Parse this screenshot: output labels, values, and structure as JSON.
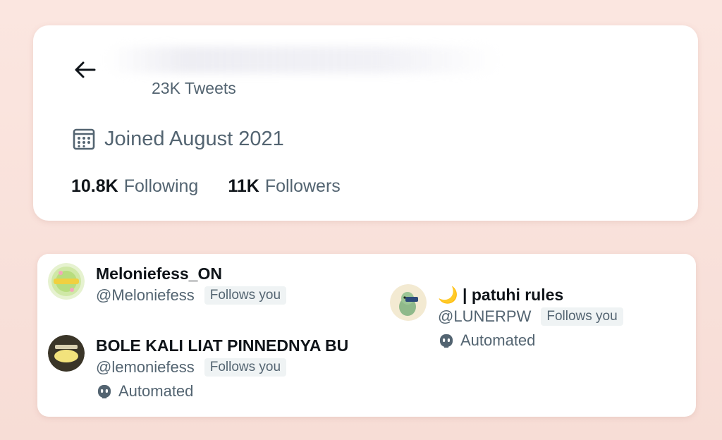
{
  "profile": {
    "tweets_count": "23K Tweets",
    "joined": "Joined August 2021",
    "following_count": "10.8K",
    "following_label": "Following",
    "followers_count": "11K",
    "followers_label": "Followers"
  },
  "icons": {
    "back": "arrow-left-icon",
    "calendar": "calendar-icon",
    "automated": "robot-icon"
  },
  "users": [
    {
      "name": "Meloniefess_ON",
      "handle": "@Meloniefess",
      "badge": "Follows you"
    },
    {
      "name": "BOLE KALI LIAT PINNEDNYA BU",
      "handle": "@lemoniefess",
      "badge": "Follows you",
      "automated": "Automated"
    },
    {
      "name": "🌙 | patuhi rules",
      "handle": "@LUNERPW",
      "badge": "Follows you",
      "automated": "Automated"
    }
  ],
  "colors": {
    "background": "#f9e2dc",
    "card": "#ffffff",
    "secondary_text": "#536471",
    "primary_text": "#0f1419",
    "badge_bg": "#eff3f4"
  }
}
